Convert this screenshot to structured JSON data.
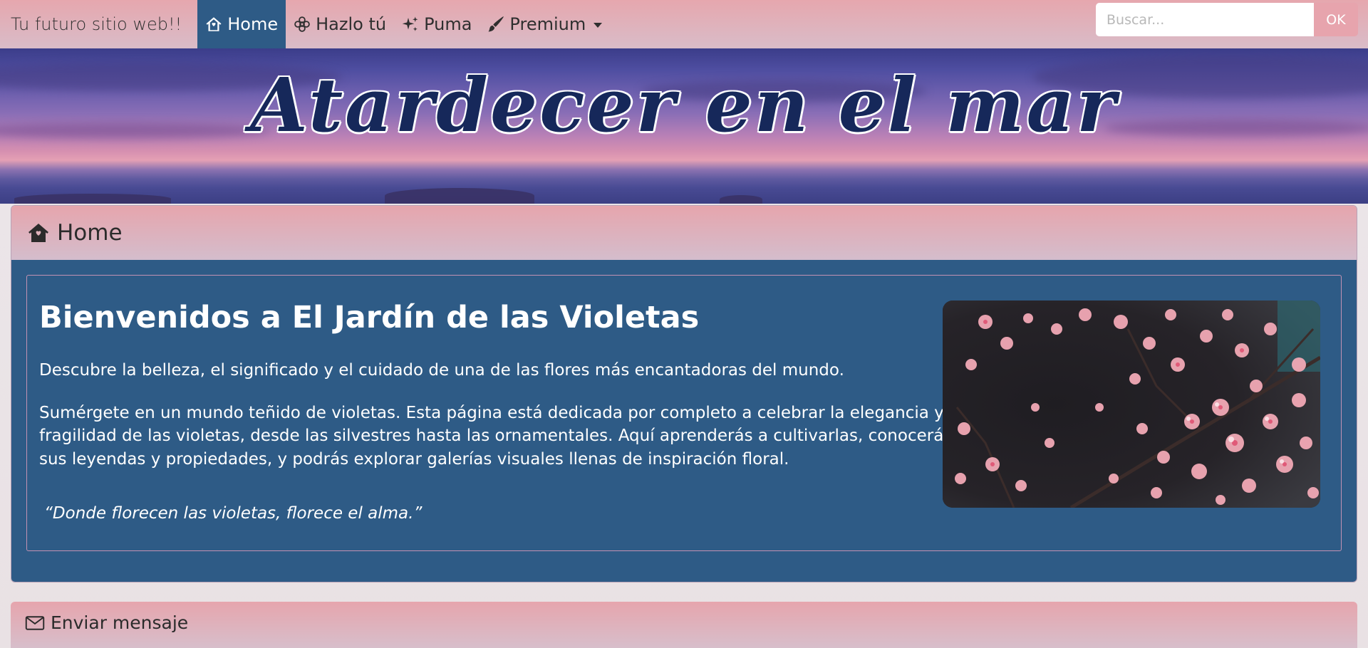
{
  "navbar": {
    "brand": "Tu futuro sitio web!!",
    "items": [
      {
        "label": "Home",
        "icon": "house-heart-icon",
        "active": true
      },
      {
        "label": "Hazlo tú",
        "icon": "flower-icon",
        "active": false
      },
      {
        "label": "Puma",
        "icon": "sparkles-icon",
        "active": false
      },
      {
        "label": "Premium",
        "icon": "brush-icon",
        "active": false,
        "dropdown": true
      }
    ],
    "search": {
      "placeholder": "Buscar...",
      "value": "",
      "button_label": "OK"
    }
  },
  "hero": {
    "title": "Atardecer en el mar"
  },
  "main_card": {
    "header": {
      "label": "Home",
      "icon": "house-heart-icon"
    },
    "heading": "Bienvenidos a El Jardín de las Violetas",
    "lead": "Descubre la belleza, el significado y el cuidado de una de las flores más encantadoras del mundo.",
    "body": "Sumérgete en un mundo teñido de violetas. Esta página está dedicada por completo a celebrar la elegancia y fragilidad de las violetas, desde las silvestres hasta las ornamentales. Aquí aprenderás a cultivarlas, conocerás sus leyendas y propiedades, y podrás explorar galerías visuales llenas de inspiración floral.",
    "quote": "“Donde florecen las violetas, florece el alma.”"
  },
  "message_card": {
    "label": "Enviar mensaje",
    "icon": "envelope-icon"
  },
  "colors": {
    "navbar_pink": "#e6a7ae",
    "active_blue": "#2e5b86",
    "search_button": "#e7a4ad",
    "title_navy": "#16285a"
  }
}
